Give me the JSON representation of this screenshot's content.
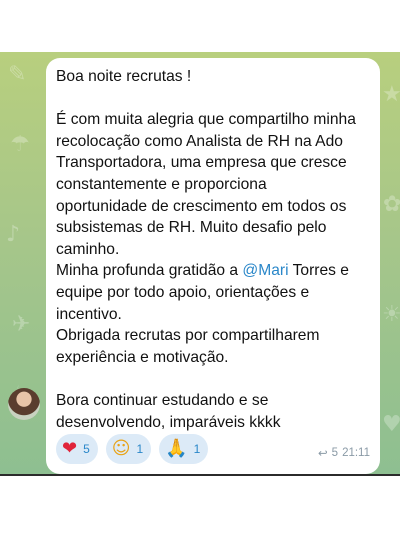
{
  "message": {
    "lines": [
      "Boa noite recrutas !",
      "",
      "É com muita alegria que compartilho minha",
      "recolocação como Analista de RH na Ado",
      "Transportadora, uma empresa que cresce",
      "constantemente e proporciona",
      "oportunidade de crescimento em todos os",
      "subsistemas de RH. Muito desafio pelo",
      "caminho."
    ],
    "gratitude_before": "Minha profunda gratidão a ",
    "mention": "@Mari",
    "gratitude_after": " Torres e",
    "lines_after": [
      "equipe por todo apoio, orientações e",
      "incentivo.",
      "Obrigada recrutas por compartilharem",
      "experiência e motivação.",
      "",
      "Bora continuar estudando e se",
      "desenvolvendo, imparáveis kkkk"
    ]
  },
  "reactions": [
    {
      "emoji": "❤",
      "emoji_color": "#e0243a",
      "count": "5",
      "icon": "heart-icon"
    },
    {
      "emoji": "☺",
      "emoji_color": "#e8a317",
      "count": "1",
      "icon": "smiling-face-with-hearts-icon"
    },
    {
      "emoji": "🙏",
      "emoji_color": "#e8a317",
      "count": "1",
      "icon": "folded-hands-icon"
    }
  ],
  "meta": {
    "reply_icon": "↩",
    "reply_count": "5",
    "time": "21:11"
  },
  "colors": {
    "accent": "#2a87c9",
    "bubble": "#ffffff",
    "reaction_bg": "#dceaf7"
  }
}
